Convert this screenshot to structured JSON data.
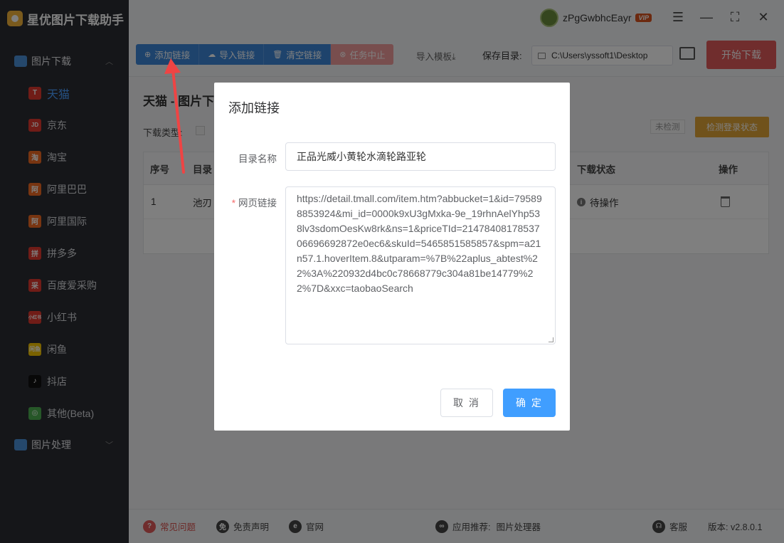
{
  "app": {
    "title": "星优图片下载助手"
  },
  "user": {
    "name": "zPgGwbhcEayr",
    "badge": "VIP"
  },
  "sidebar": {
    "group1": "图片下载",
    "items": [
      {
        "label": "天猫",
        "icon": "T",
        "color": "#e0392f"
      },
      {
        "label": "京东",
        "icon": "JD",
        "color": "#e0392f"
      },
      {
        "label": "淘宝",
        "icon": "淘",
        "color": "#f06a22"
      },
      {
        "label": "阿里巴巴",
        "icon": "阿",
        "color": "#f06a22"
      },
      {
        "label": "阿里国际",
        "icon": "阿",
        "color": "#f06a22"
      },
      {
        "label": "拼多多",
        "icon": "拼",
        "color": "#e0392f"
      },
      {
        "label": "百度爱采购",
        "icon": "采",
        "color": "#e0392f"
      },
      {
        "label": "小红书",
        "icon": "小红书",
        "color": "#e0392f"
      },
      {
        "label": "闲鱼",
        "icon": "闲鱼",
        "color": "#f5c400"
      },
      {
        "label": "抖店",
        "icon": "♪",
        "color": "#111111"
      },
      {
        "label": "其他(Beta)",
        "icon": "◎",
        "color": "#4caf50"
      }
    ],
    "group2": "图片处理"
  },
  "toolbar": {
    "add": "添加链接",
    "import": "导入链接",
    "clear": "清空链接",
    "stop": "任务中止",
    "template": "导入模板⤓",
    "save_label": "保存目录:",
    "save_path": "C:\\Users\\yssoft1\\Desktop",
    "start": "开始下载"
  },
  "content": {
    "heading": "天猫 - 图片下",
    "dl_type": "下载类型:",
    "status_tag": "未检测",
    "check_login": "检测登录状态",
    "table": {
      "headers": {
        "index": "序号",
        "dir": "目录",
        "status": "下载状态",
        "action": "操作"
      },
      "rows": [
        {
          "index": "1",
          "dir": "池刃",
          "status": "待操作"
        }
      ]
    }
  },
  "footer": {
    "faq": "常见问题",
    "disclaimer": "免责声明",
    "site": "官网",
    "recommend": "应用推荐:",
    "recommend_app": "图片处理器",
    "service": "客服",
    "version": "版本: v2.8.0.1"
  },
  "dialog": {
    "title": "添加链接",
    "name_label": "目录名称",
    "name_value": "正品光威小黄轮水滴轮路亚轮",
    "url_label": "网页链接",
    "url_value": "https://detail.tmall.com/item.htm?abbucket=1&id=795898853924&mi_id=0000k9xU3gMxka-9e_19rhnAelYhp538lv3sdomOesKw8rk&ns=1&priceTId=2147840817853706696692872e0ec6&skuId=5465851585857&spm=a21n57.1.hoverItem.8&utparam=%7B%22aplus_abtest%22%3A%220932d4bc0c78668779c304a81be14779%22%7D&xxc=taobaoSearch",
    "cancel": "取 消",
    "ok": "确 定"
  },
  "colors": {
    "accent": "#409eff",
    "danger": "#e05a5a",
    "sidebar": "#2b2d33"
  }
}
